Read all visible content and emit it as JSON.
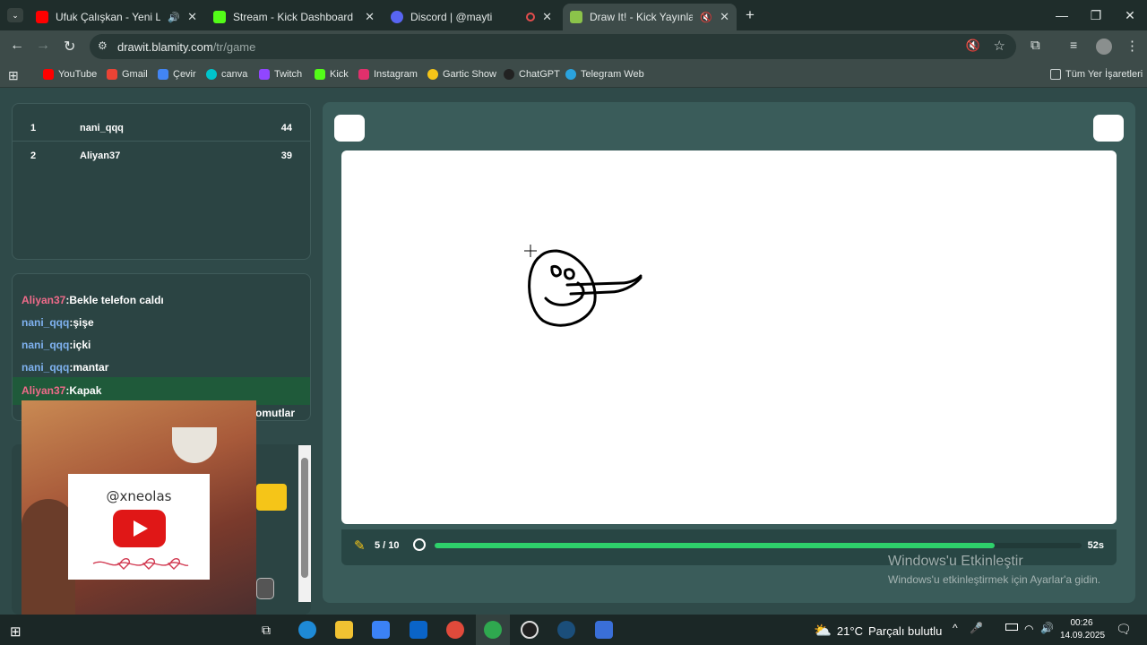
{
  "browser": {
    "tabs": [
      {
        "title": "Ufuk Çalışkan - Yeni Limanla",
        "favicon": "youtube-icon",
        "color": "#ff0000",
        "muted": false,
        "recording": false
      },
      {
        "title": "Stream - Kick Dashboard",
        "favicon": "kick-icon",
        "color": "#53fc18",
        "muted": false,
        "recording": false
      },
      {
        "title": "Discord | @mayti",
        "favicon": "discord-icon",
        "color": "#5865f2",
        "muted": false,
        "recording": true
      },
      {
        "title": "Draw It! - Kick Yayınları İçin",
        "favicon": "drawit-icon",
        "color": "#8bc34a",
        "muted": true,
        "recording": false
      }
    ],
    "url": "drawit.blamity.com",
    "url_path": "/tr/game",
    "bookmarks": [
      {
        "label": "YouTube",
        "color": "#ff0000"
      },
      {
        "label": "Gmail",
        "color": "#ea4335"
      },
      {
        "label": "Çevir",
        "color": "#4285f4"
      },
      {
        "label": "canva",
        "color": "#00c4cc"
      },
      {
        "label": "Twitch",
        "color": "#9146ff"
      },
      {
        "label": "Kick",
        "color": "#53fc18"
      },
      {
        "label": "Instagram",
        "color": "#e1306c"
      },
      {
        "label": "Gartic Show",
        "color": "#f5c518"
      },
      {
        "label": "ChatGPT",
        "color": "#222222"
      },
      {
        "label": "Telegram Web",
        "color": "#2aa3de"
      }
    ],
    "all_bookmarks": "Tüm Yer İşaretleri"
  },
  "leaderboard": [
    {
      "rank": "1",
      "name": "nani_qqq",
      "score": "44"
    },
    {
      "rank": "2",
      "name": "Aliyan37",
      "score": "39"
    }
  ],
  "chat": [
    {
      "user": "Aliyan37",
      "text": "Bekle telefon caldı",
      "user_color": "#f06b8a",
      "highlight": false
    },
    {
      "user": "nani_qqq",
      "text": "şişe",
      "user_color": "#7fb2f0",
      "highlight": false
    },
    {
      "user": "nani_qqq",
      "text": "içki",
      "user_color": "#7fb2f0",
      "highlight": false
    },
    {
      "user": "nani_qqq",
      "text": "mantar",
      "user_color": "#7fb2f0",
      "highlight": false
    },
    {
      "user": "Aliyan37",
      "text": "Kapak",
      "user_color": "#f06b8a",
      "highlight": true
    }
  ],
  "chat_partial": "omutlar",
  "overlay": {
    "handle": "@xneolas"
  },
  "game": {
    "round": "5 / 10",
    "timer": "52s",
    "progress_fraction": 0.865
  },
  "watermark": {
    "title": "Windows'u Etkinleştir",
    "subtitle": "Windows'u etkinleştirmek için Ayarlar'a gidin."
  },
  "taskbar": {
    "weather_temp": "21°C",
    "weather_desc": "Parçalı bulutlu",
    "time": "00:26",
    "date": "14.09.2025"
  },
  "colors": {
    "accent_green": "#2ed16b",
    "yellow_button": "#f5c518"
  }
}
